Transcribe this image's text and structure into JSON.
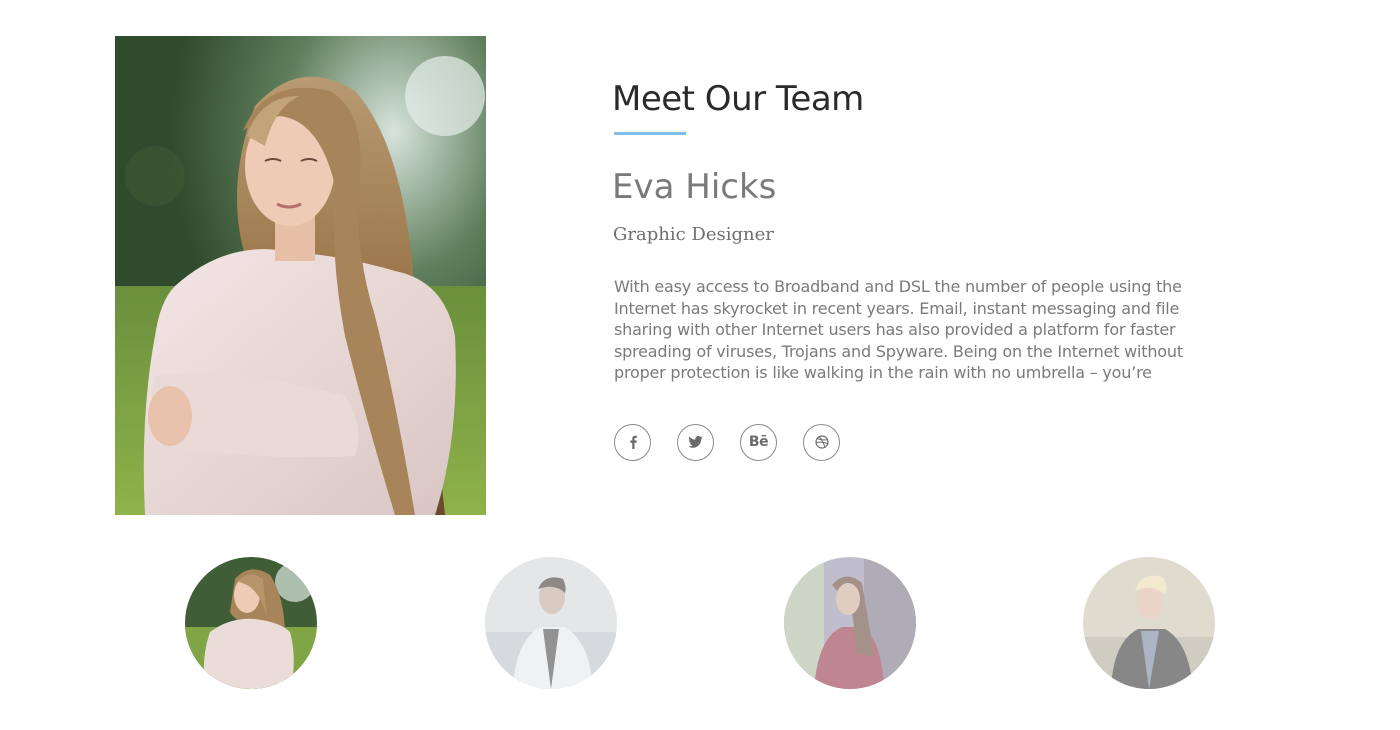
{
  "section": {
    "title": "Meet Our Team"
  },
  "member": {
    "name": "Eva Hicks",
    "role": "Graphic Designer",
    "bio": "With easy access to Broadband and DSL the number of people using the Internet has skyrocket in recent years. Email, instant messaging and file sharing with other Internet users has also provided a platform for faster spreading of viruses, Trojans and Spyware. Being on the Internet without proper protection is like walking in the rain with no umbrella – you’re"
  },
  "social": [
    {
      "icon": "facebook-icon"
    },
    {
      "icon": "twitter-icon"
    },
    {
      "icon": "behance-icon",
      "glyph": "Bē"
    },
    {
      "icon": "dribbble-icon"
    }
  ],
  "thumbnails": [
    {
      "name": "eva-hicks",
      "active": true
    },
    {
      "name": "team-member-2",
      "active": false
    },
    {
      "name": "team-member-3",
      "active": false
    },
    {
      "name": "team-member-4",
      "active": false
    }
  ],
  "colors": {
    "accent": "#7fbde8",
    "title": "#2a2a2a",
    "text": "#7a7a7a"
  }
}
